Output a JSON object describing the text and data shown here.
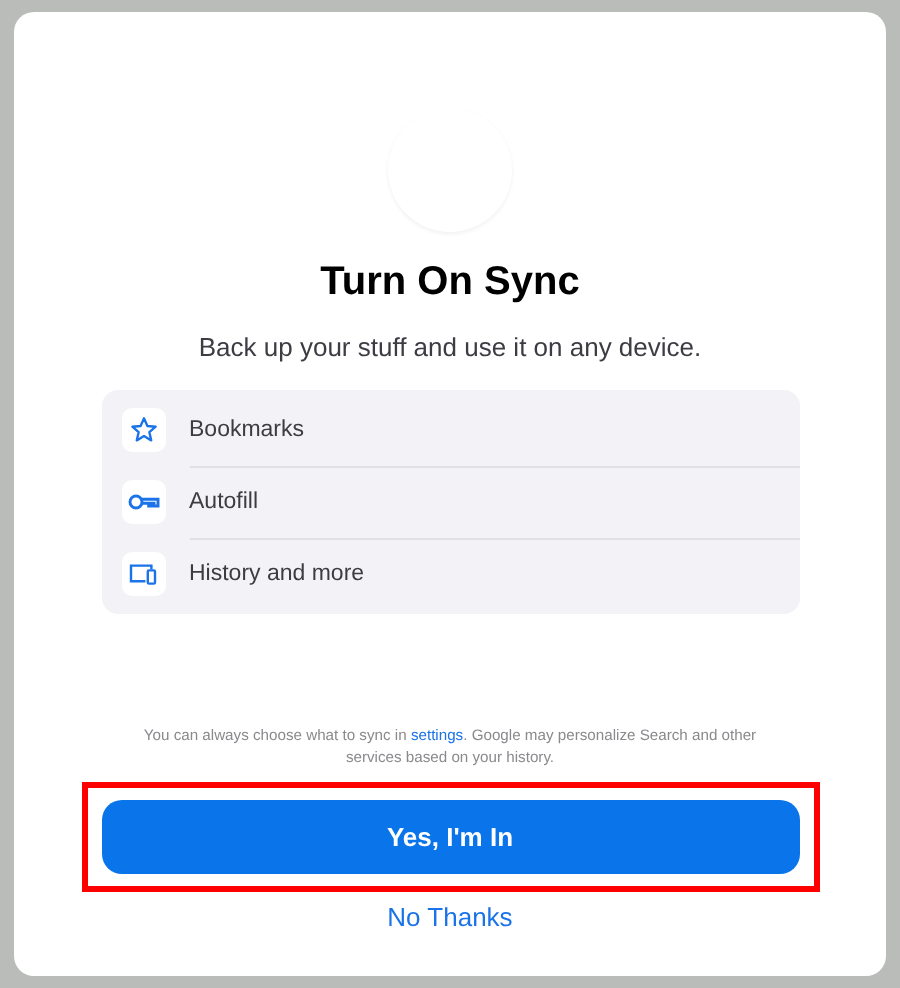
{
  "title": "Turn On Sync",
  "subtitle": "Back up your stuff and use it on any device.",
  "items": [
    {
      "kind": "star",
      "label": "Bookmarks"
    },
    {
      "kind": "key",
      "label": "Autofill"
    },
    {
      "kind": "devices",
      "label": "History and more"
    }
  ],
  "footer": {
    "before": "You can always choose what to sync in ",
    "link": "settings",
    "after": ". Google may personalize Search and other services based on your history."
  },
  "primary_button": {
    "label": "Yes, I'm In",
    "highlighted": true
  },
  "secondary_button": {
    "label": "No Thanks"
  }
}
